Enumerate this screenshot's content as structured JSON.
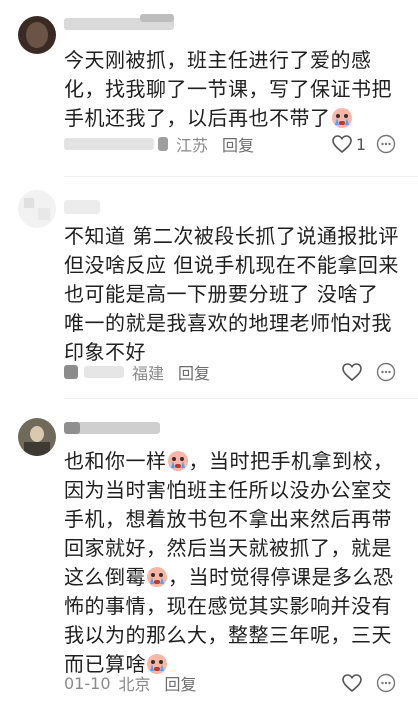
{
  "comments": [
    {
      "text_parts": [
        "今天刚被抓，班主任进行了爱的感化，找我聊了一节课，写了保证书把手机还我了，以后再也不带了"
      ],
      "emoji": "crying-emoji",
      "location": "江苏",
      "reply_label": "回复",
      "like_count": "1"
    },
    {
      "text_parts": [
        "不知道 第二次被段长抓了说通报批评但没啥反应 但说手机现在不能拿回来 也可能是高一下册要分班了 没啥了 唯一的就是我喜欢的地理老师怕对我印象不好"
      ],
      "location": "福建",
      "reply_label": "回复",
      "like_count": ""
    },
    {
      "text_parts": [
        "也和你一样",
        "，当时把手机拿到校，因为当时害怕班主任所以没办公室交手机，想着放书包不拿出来然后再带回家就好，然后当天就被抓了，就是这么倒霉",
        "，当时觉得停课是多么恐怖的事情，现在感觉其实影响并没有我以为的那么大，整整三年呢，三天而已算啥"
      ],
      "emoji": "crying-emoji",
      "time": "01-10",
      "location": "北京",
      "reply_label": "回复",
      "like_count": ""
    }
  ]
}
